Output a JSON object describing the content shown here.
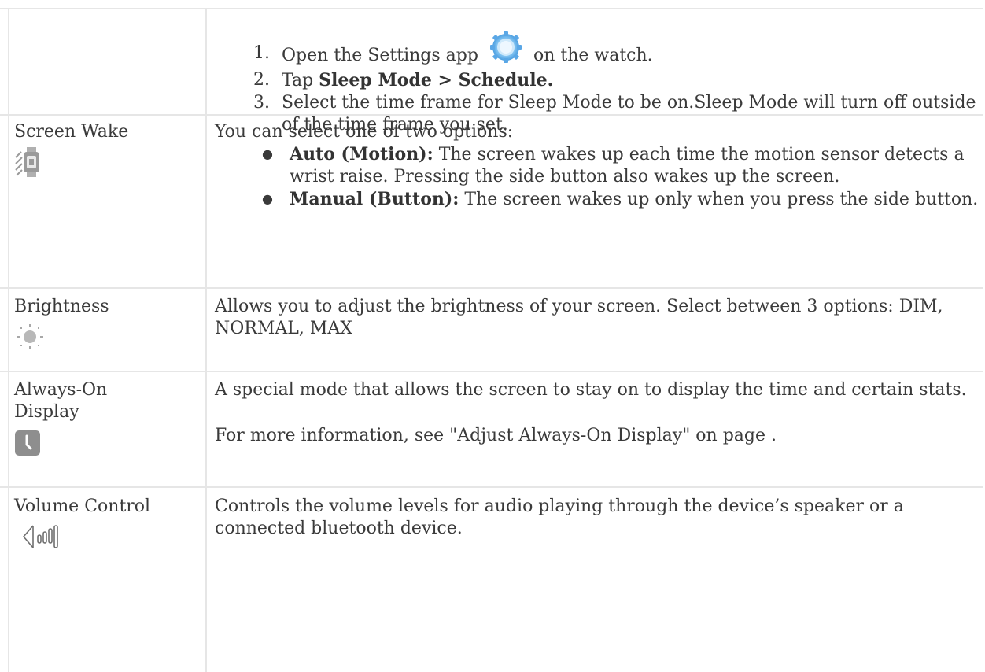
{
  "sleep_mode": {
    "steps": [
      {
        "num": "1.",
        "before": "Open the Settings app",
        "after": "on the watch."
      },
      {
        "num": "2.",
        "before": "Tap",
        "bold": "Sleep Mode > Schedule."
      },
      {
        "num": "3.",
        "text": "Select the time frame for Sleep Mode to be on.Sleep Mode will turn off outside of the time frame you set."
      }
    ],
    "icon": "settings-gear-icon"
  },
  "rows": {
    "screen_wake": {
      "label": "Screen Wake",
      "icon": "watch-motion-icon",
      "intro": "You can select one of two options:",
      "options": [
        {
          "bold": "Auto (Motion):",
          "text": "The screen wakes up each time the motion sensor detects a wrist raise. Pressing the side button also wakes up the screen."
        },
        {
          "bold": "Manual (Button):",
          "text": "The screen wakes up only when you press the side button."
        }
      ]
    },
    "brightness": {
      "label": "Brightness",
      "icon": "brightness-sun-icon",
      "text": "Allows you to adjust the brightness of your screen. Select between 3 options: DIM, NORMAL, MAX"
    },
    "always_on": {
      "label": "Always-On Display",
      "icon": "clock-icon",
      "text": "A special mode that allows the screen to stay on to display the time and certain stats.",
      "more": "For more information, see \"Adjust Always-On Display\" on page ."
    },
    "volume": {
      "label": "Volume Control",
      "icon": "volume-icon",
      "text": "Controls the volume levels for audio playing through the device’s speaker or a connected bluetooth device."
    }
  },
  "colors": {
    "text": "#3a3a3a",
    "border": "#e6e6e6",
    "settings_icon": "#5aa7e6",
    "icon_gray": "#8a8a8a"
  }
}
